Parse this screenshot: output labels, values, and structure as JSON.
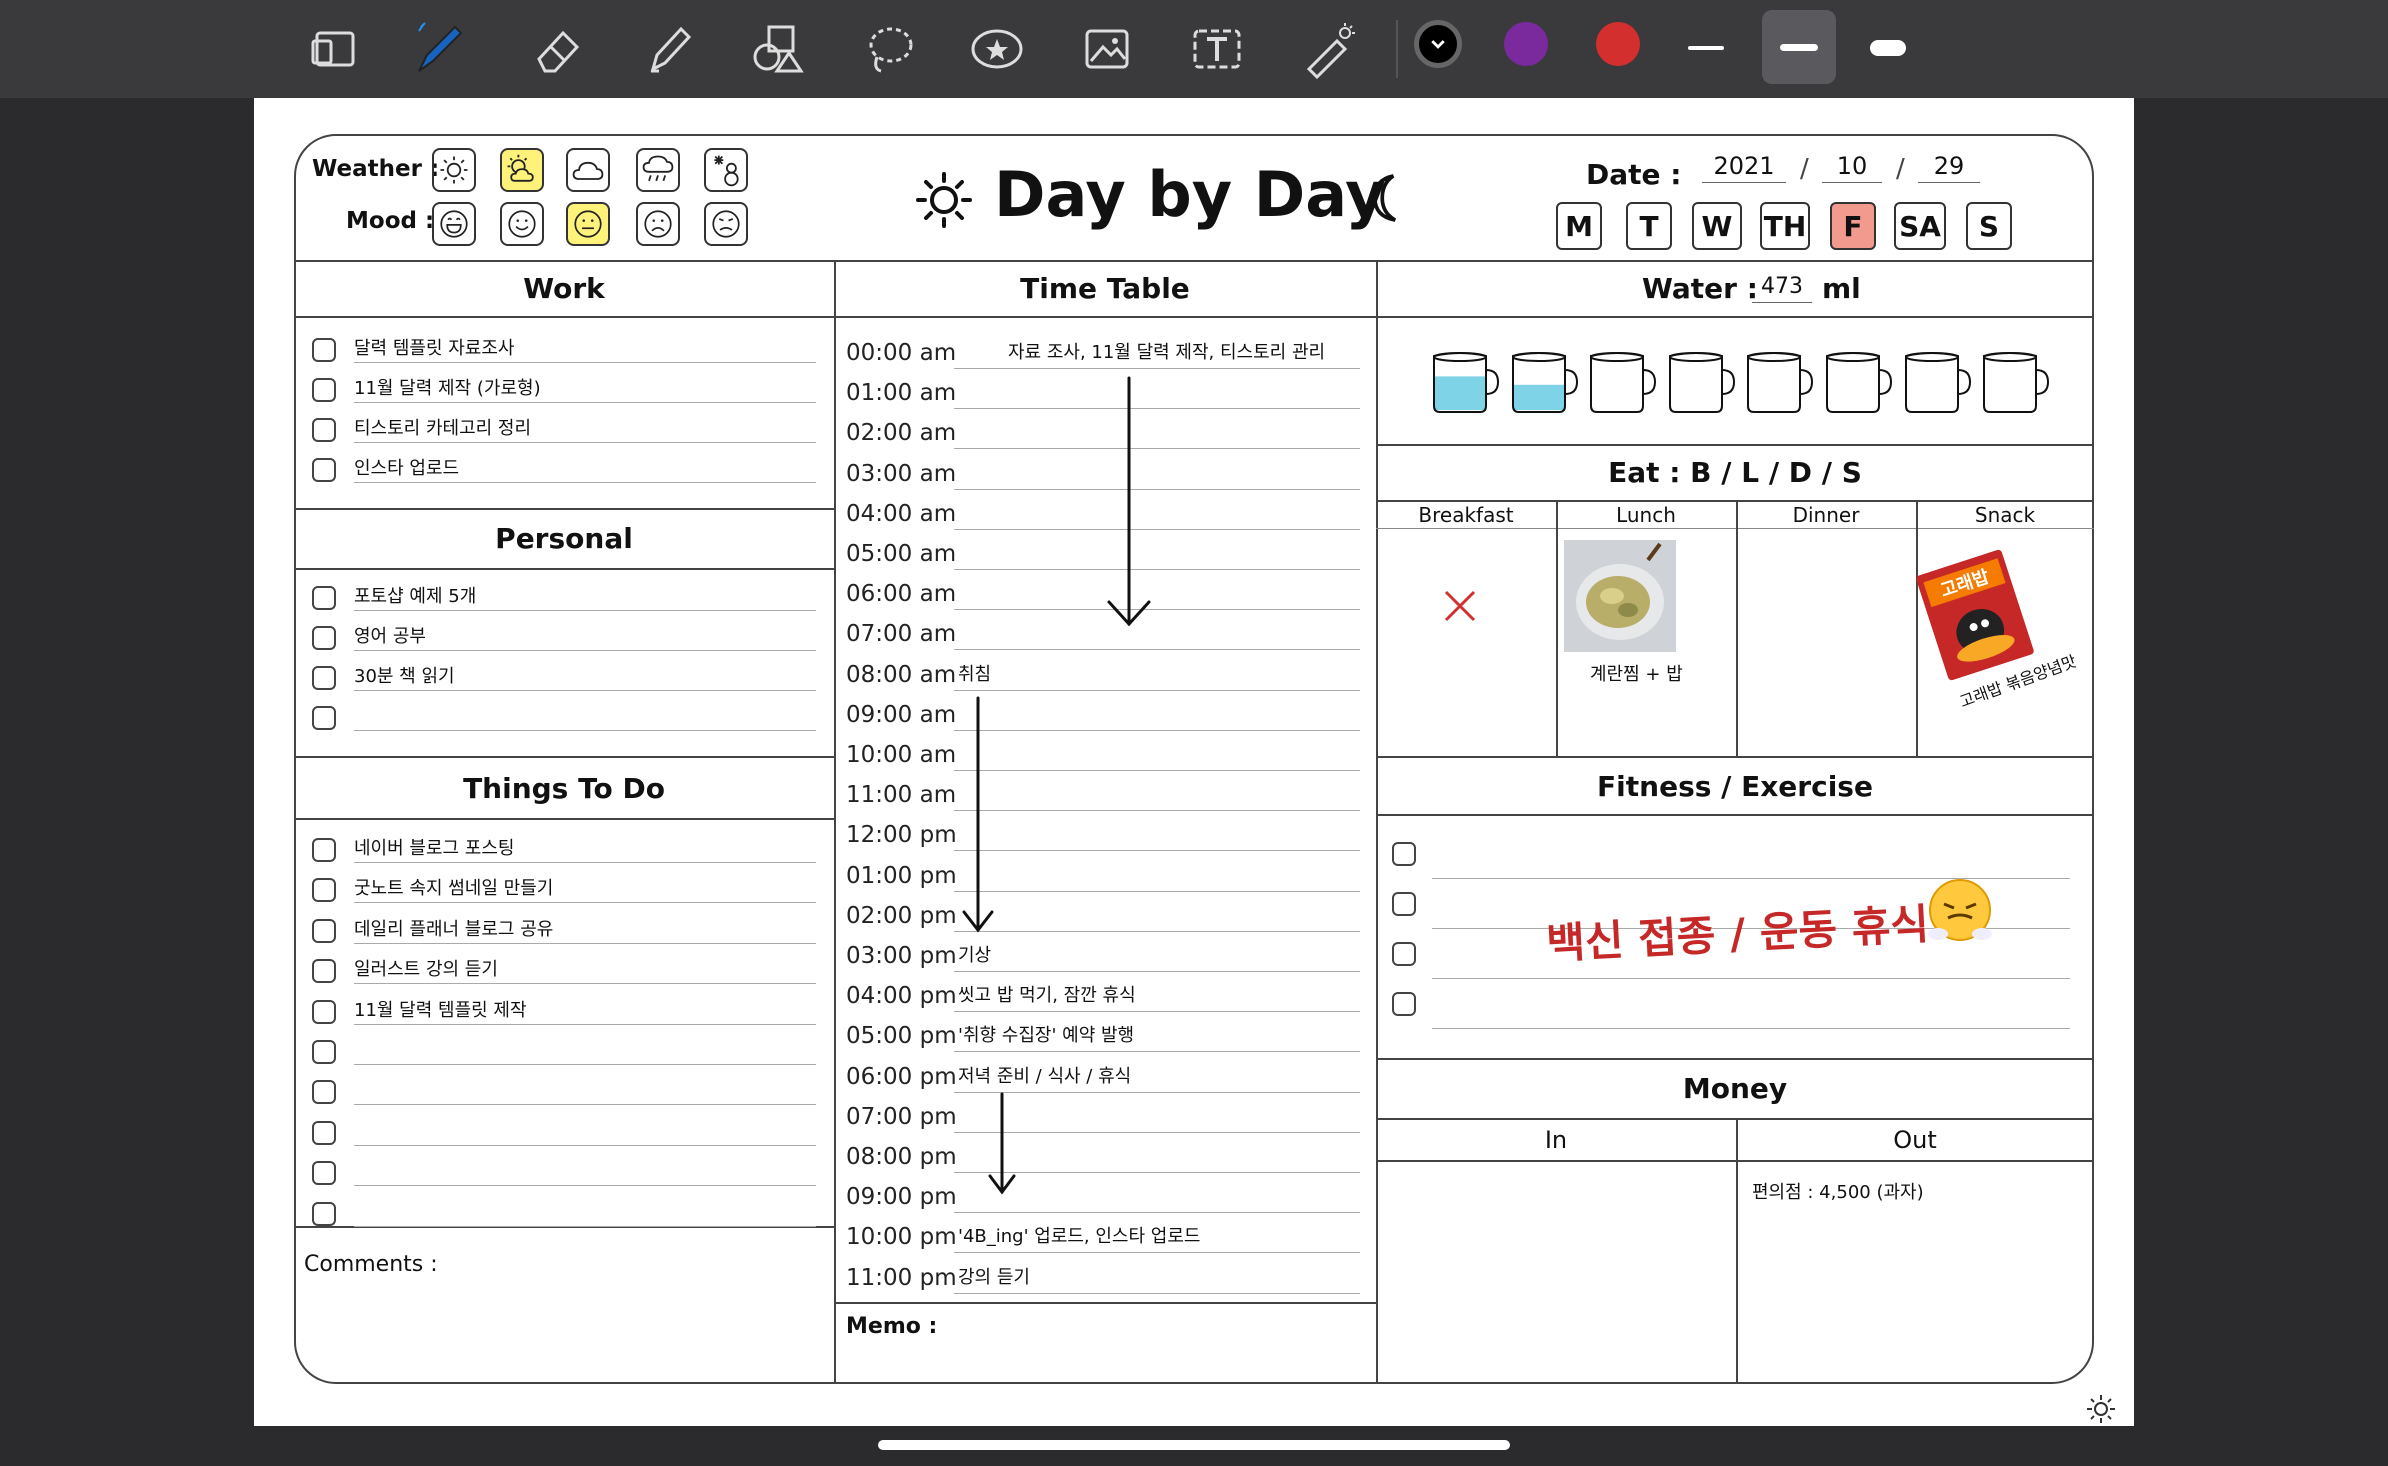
{
  "toolbar": {
    "tools": [
      "page-layout-icon",
      "pen-icon",
      "eraser-icon",
      "highlighter-icon",
      "shapes-icon",
      "lasso-icon",
      "sticker-icon",
      "image-icon",
      "text-icon",
      "laser-pointer-icon"
    ],
    "colors": [
      "#000000",
      "#7a2a9c",
      "#d32f2f"
    ],
    "selected_color": "#000000"
  },
  "header": {
    "weather_label": "Weather :",
    "mood_label": "Mood :",
    "title": "Day by Day",
    "date_label": "Date :",
    "year": "2021",
    "month": "10",
    "day": "29",
    "date_sep": "/",
    "days": [
      "M",
      "T",
      "W",
      "TH",
      "F",
      "SA",
      "S"
    ],
    "selected_day": "F"
  },
  "work": {
    "title": "Work",
    "items": [
      "달력 템플릿 자료조사",
      "11월 달력 제작 (가로형)",
      "티스토리 카테고리 정리",
      "인스타 업로드"
    ]
  },
  "personal": {
    "title": "Personal",
    "items": [
      "포토샵 예제 5개",
      "영어 공부",
      "30분 책 읽기",
      ""
    ]
  },
  "todo": {
    "title": "Things To Do",
    "items": [
      "네이버 블로그 포스팅",
      "굿노트 속지 썸네일 만들기",
      "데일리 플래너 블로그 공유",
      "일러스트 강의 듣기",
      "11월 달력 템플릿 제작",
      "",
      "",
      "",
      "",
      ""
    ]
  },
  "comments_label": "Comments :",
  "timetable": {
    "title": "Time Table",
    "slots": [
      "00:00 am",
      "01:00 am",
      "02:00 am",
      "03:00 am",
      "04:00 am",
      "05:00 am",
      "06:00 am",
      "07:00 am",
      "08:00 am",
      "09:00 am",
      "10:00 am",
      "11:00 am",
      "12:00 pm",
      "01:00 pm",
      "02:00 pm",
      "03:00 pm",
      "04:00 pm",
      "05:00 pm",
      "06:00 pm",
      "07:00 pm",
      "08:00 pm",
      "09:00 pm",
      "10:00 pm",
      "11:00 pm"
    ],
    "notes": {
      "n0": "자료 조사, 11월 달력 제작, 티스토리 관리",
      "n8": "취침",
      "n15": "기상",
      "n16": "씻고 밥 먹기, 잠깐 휴식",
      "n17": "'취향 수집장' 예약 발행",
      "n18": "저녁 준비 / 식사 / 휴식",
      "n22": "'4B_ing' 업로드, 인스타 업로드",
      "n23": "강의 듣기"
    },
    "memo_label": "Memo :"
  },
  "water": {
    "label": "Water :",
    "amount": "473",
    "unit": "ml",
    "cups_total": 8,
    "cups_filled": [
      0.6,
      0.45,
      0,
      0,
      0,
      0,
      0,
      0
    ]
  },
  "eat": {
    "title": "Eat : B / L / D / S",
    "columns": [
      "Breakfast",
      "Lunch",
      "Dinner",
      "Snack"
    ],
    "lunch_note": "계란찜 + 밥",
    "snack_note": "고래밥 볶음양념맛",
    "snack_brand": "고래밥"
  },
  "fitness": {
    "title": "Fitness / Exercise",
    "note": "백신 접종 / 운동 휴식."
  },
  "money": {
    "title": "Money",
    "in_label": "In",
    "out_label": "Out",
    "out_items": [
      "편의점 : 4,500 (과자)"
    ]
  }
}
